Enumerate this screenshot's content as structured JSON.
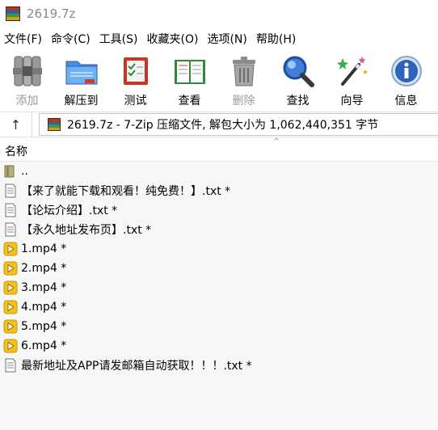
{
  "window": {
    "title": "2619.7z"
  },
  "menu": [
    "文件(F)",
    "命令(C)",
    "工具(S)",
    "收藏夹(O)",
    "选项(N)",
    "帮助(H)"
  ],
  "toolbar": [
    {
      "label": "添加",
      "icon": "add-icon",
      "disabled": true
    },
    {
      "label": "解压到",
      "icon": "extract-folder-icon",
      "disabled": false
    },
    {
      "label": "测试",
      "icon": "test-checklist-icon",
      "disabled": false
    },
    {
      "label": "查看",
      "icon": "view-book-icon",
      "disabled": false
    },
    {
      "label": "删除",
      "icon": "trash-icon",
      "disabled": true
    },
    {
      "label": "查找",
      "icon": "magnifier-icon",
      "disabled": false
    },
    {
      "label": "向导",
      "icon": "wizard-wand-icon",
      "disabled": false
    },
    {
      "label": "信息",
      "icon": "info-icon",
      "disabled": false
    }
  ],
  "address": {
    "up_symbol": "↑",
    "path": "2619.7z - 7-Zip 压缩文件, 解包大小为 1,062,440,351 字节"
  },
  "list": {
    "column_name": "名称",
    "sort_indicator": "^",
    "items": [
      {
        "name": "..",
        "type": "parent"
      },
      {
        "name": "【来了就能下载和观看！纯免费！】.txt *",
        "type": "txt"
      },
      {
        "name": "【论坛介绍】.txt *",
        "type": "txt"
      },
      {
        "name": "【永久地址发布页】.txt *",
        "type": "txt"
      },
      {
        "name": "1.mp4 *",
        "type": "mp4"
      },
      {
        "name": "2.mp4 *",
        "type": "mp4"
      },
      {
        "name": "3.mp4 *",
        "type": "mp4"
      },
      {
        "name": "4.mp4 *",
        "type": "mp4"
      },
      {
        "name": "5.mp4 *",
        "type": "mp4"
      },
      {
        "name": "6.mp4 *",
        "type": "mp4"
      },
      {
        "name": "最新地址及APP请发邮箱自动获取！！！.txt *",
        "type": "txt"
      }
    ]
  },
  "colors": {
    "selected_row": "#f7f7f7",
    "disabled_text": "#9a9a9a",
    "title_text": "#8a8a8a",
    "mp4_icon": "#f2c21a"
  }
}
